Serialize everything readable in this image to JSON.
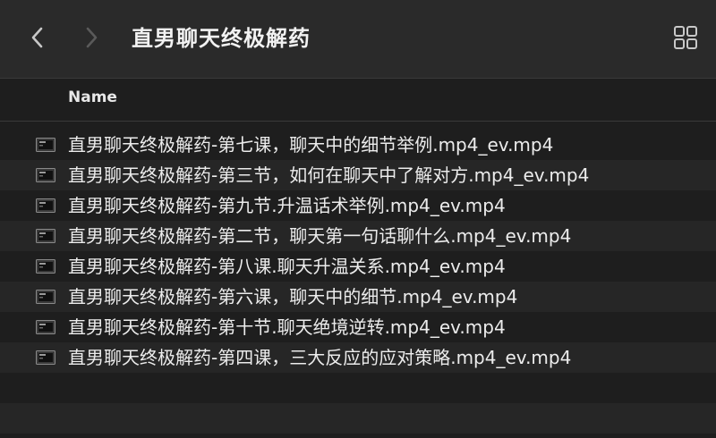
{
  "window": {
    "title": "直男聊天终极解药"
  },
  "toolbar": {
    "back_icon": "chevron-left-icon",
    "forward_icon": "chevron-right-icon",
    "view_icon": "grid-view-icon"
  },
  "columns": {
    "name": "Name"
  },
  "files": [
    {
      "name": "直男聊天终极解药-第七课，聊天中的细节举例.mp4_ev.mp4",
      "icon": "video-file-icon"
    },
    {
      "name": "直男聊天终极解药-第三节，如何在聊天中了解对方.mp4_ev.mp4",
      "icon": "video-file-icon"
    },
    {
      "name": "直男聊天终极解药-第九节.升温话术举例.mp4_ev.mp4",
      "icon": "video-file-icon"
    },
    {
      "name": "直男聊天终极解药-第二节，聊天第一句话聊什么.mp4_ev.mp4",
      "icon": "video-file-icon"
    },
    {
      "name": "直男聊天终极解药-第八课.聊天升温关系.mp4_ev.mp4",
      "icon": "video-file-icon"
    },
    {
      "name": "直男聊天终极解药-第六课，聊天中的细节.mp4_ev.mp4",
      "icon": "video-file-icon"
    },
    {
      "name": "直男聊天终极解药-第十节.聊天绝境逆转.mp4_ev.mp4",
      "icon": "video-file-icon"
    },
    {
      "name": "直男聊天终极解药-第四课，三大反应的应对策略.mp4_ev.mp4",
      "icon": "video-file-icon"
    }
  ],
  "colors": {
    "toolbar_bg": "#2a2a2a",
    "list_bg": "#1e1e1e",
    "alt_row_bg": "#262626",
    "text": "#ececec"
  }
}
